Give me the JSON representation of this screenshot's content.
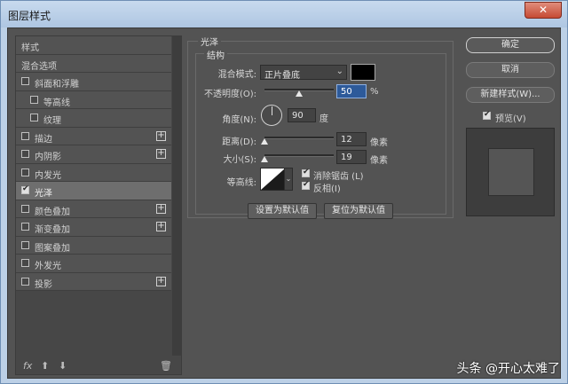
{
  "window": {
    "title": "图层样式",
    "close": "✕"
  },
  "sidebar": {
    "items": [
      {
        "label": "样式",
        "checkbox": false,
        "checked": false,
        "indent": false,
        "plus": false,
        "selected": false
      },
      {
        "label": "混合选项",
        "checkbox": false,
        "checked": false,
        "indent": false,
        "plus": false,
        "selected": false
      },
      {
        "label": "斜面和浮雕",
        "checkbox": true,
        "checked": false,
        "indent": false,
        "plus": false,
        "selected": false
      },
      {
        "label": "等高线",
        "checkbox": true,
        "checked": false,
        "indent": true,
        "plus": false,
        "selected": false
      },
      {
        "label": "纹理",
        "checkbox": true,
        "checked": false,
        "indent": true,
        "plus": false,
        "selected": false
      },
      {
        "label": "描边",
        "checkbox": true,
        "checked": false,
        "indent": false,
        "plus": true,
        "selected": false
      },
      {
        "label": "内阴影",
        "checkbox": true,
        "checked": false,
        "indent": false,
        "plus": true,
        "selected": false
      },
      {
        "label": "内发光",
        "checkbox": true,
        "checked": false,
        "indent": false,
        "plus": false,
        "selected": false
      },
      {
        "label": "光泽",
        "checkbox": true,
        "checked": true,
        "indent": false,
        "plus": false,
        "selected": true
      },
      {
        "label": "颜色叠加",
        "checkbox": true,
        "checked": false,
        "indent": false,
        "plus": true,
        "selected": false
      },
      {
        "label": "渐变叠加",
        "checkbox": true,
        "checked": false,
        "indent": false,
        "plus": true,
        "selected": false
      },
      {
        "label": "图案叠加",
        "checkbox": true,
        "checked": false,
        "indent": false,
        "plus": false,
        "selected": false
      },
      {
        "label": "外发光",
        "checkbox": true,
        "checked": false,
        "indent": false,
        "plus": false,
        "selected": false
      },
      {
        "label": "投影",
        "checkbox": true,
        "checked": false,
        "indent": false,
        "plus": true,
        "selected": false
      }
    ],
    "bottom": {
      "fx": "fx",
      "up": "⬆",
      "down": "⬇",
      "trash": "🗑"
    }
  },
  "gloss": {
    "title": "光泽",
    "structure_title": "结构",
    "blend_mode_label": "混合模式:",
    "blend_mode_value": "正片叠底",
    "color": "#000000",
    "opacity_label": "不透明度(O):",
    "opacity_value": "50",
    "opacity_fraction": 0.5,
    "percent": "%",
    "angle_label": "角度(N):",
    "angle_value": "90",
    "angle_deg": 90,
    "angle_unit": "度",
    "distance_label": "距离(D):",
    "distance_value": "12",
    "distance_fraction": 0.0,
    "distance_unit": "像素",
    "size_label": "大小(S):",
    "size_value": "19",
    "size_fraction": 0.0,
    "size_unit": "像素",
    "contour_label": "等高线:",
    "antialias_label": "消除锯齿 (L)",
    "antialias_checked": true,
    "invert_label": "反相(I)",
    "invert_checked": true,
    "set_default_label": "设置为默认值",
    "reset_default_label": "复位为默认值"
  },
  "actions": {
    "ok": "确定",
    "cancel": "取消",
    "new_style": "新建样式(W)...",
    "preview_label": "预览(V)",
    "preview_checked": true
  },
  "watermark": "头条 @开心太难了"
}
